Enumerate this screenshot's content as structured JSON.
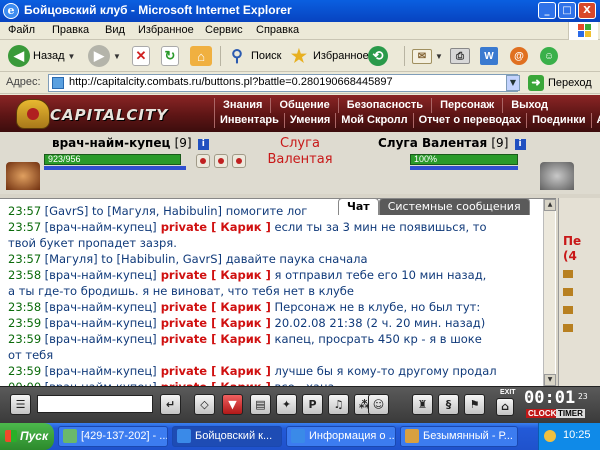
{
  "window": {
    "title": "Бойцовский клуб - Microsoft Internet Explorer",
    "minimize": "_",
    "maximize": "□",
    "close": "X"
  },
  "menu": [
    "Файл",
    "Правка",
    "Вид",
    "Избранное",
    "Сервис",
    "Справка"
  ],
  "toolbar": {
    "back": "Назад",
    "search": "Поиск",
    "favorites": "Избранное"
  },
  "address": {
    "label": "Адрес:",
    "url": "http://capitalcity.combats.ru/buttons.pl?battle=0.280190668445897",
    "go": "Переход"
  },
  "game": {
    "logo": "CAPITALCITY",
    "nav_top": [
      "Знания",
      "Общение",
      "Безопасность",
      "Персонаж",
      "Выход"
    ],
    "nav_bottom": [
      "Инвентарь",
      "Умения",
      "Мой Скролл",
      "Отчет о переводах",
      "Поединки",
      "Ан"
    ],
    "player": {
      "name": "врач-найм-купец",
      "level": "[9]",
      "hp_text": "923/956",
      "hp_fraction": 0.965
    },
    "vs_text_1": "Слуга",
    "vs_text_2": "Валентая",
    "enemy": {
      "name": "Слуга Валентая",
      "level": "[9]",
      "hp_text": "100%",
      "hp_fraction": 1.0
    },
    "tabs": {
      "chat": "Чат",
      "system": "Системные сообщения"
    },
    "chat": [
      {
        "time": "23:57",
        "nick": "[GavrS]",
        "priv": "",
        "text": " to [Магуля, Habibulin] помогите лог"
      },
      {
        "time": "23:57",
        "nick": "[врач-найм-купец]",
        "priv": " private [ Карик ]",
        "text": " если ты за 3 мин не появишься, то"
      },
      {
        "time": "",
        "nick": "",
        "priv": "",
        "text": "твой букет пропадет зазря."
      },
      {
        "time": "23:57",
        "nick": "[Магуля]",
        "priv": "",
        "text": " to [Habibulin, GavrS] давайте паука сначала"
      },
      {
        "time": "23:58",
        "nick": "[врач-найм-купец]",
        "priv": " private [ Карик ]",
        "text": " я отправил тебе его 10 мин назад,"
      },
      {
        "time": "",
        "nick": "",
        "priv": "",
        "text": "а ты где-то бродишь. я не виноват, что тебя нет в клубе"
      },
      {
        "time": "23:58",
        "nick": "[врач-найм-купец]",
        "priv": " private [ Карик ]",
        "text": " Персонаж не в клубе, но был тут:"
      },
      {
        "time": "23:59",
        "nick": "[врач-найм-купец]",
        "priv": " private [ Карик ]",
        "text": " 20.02.08 21:38 (2 ч. 20 мин. назад)"
      },
      {
        "time": "23:59",
        "nick": "[врач-найм-купец]",
        "priv": " private [ Карик ]",
        "text": " капец, просрать 450 кр - я в шоке"
      },
      {
        "time": "",
        "nick": "",
        "priv": "",
        "text": "от тебя"
      },
      {
        "time": "23:59",
        "nick": "[врач-найм-купец]",
        "priv": " private [ Карик ]",
        "text": " лучше бы я кому-то другому продал"
      },
      {
        "time": "00:00",
        "nick": "[врач-найм-купец]",
        "priv": " private [ Карик ]",
        "text": " все - хана"
      }
    ],
    "right_panel": {
      "title": "Пе",
      "sub": "(4"
    },
    "timer": {
      "digits": "00:01",
      "secs": "23",
      "clock": "CLOCK",
      "timer": "TIMER",
      "exit": "EXIT"
    }
  },
  "taskbar": {
    "start": "Пуск",
    "items": [
      "[429-137-202] - ...",
      "Бойцовский к...",
      "Информация о ...",
      "Безымянный - Р..."
    ],
    "clock": "10:25"
  },
  "colors": {
    "titlebar": "#0a5fe0",
    "game_bar": "#8a2525",
    "private_red": "#d01010",
    "chat_blue": "#103a7a",
    "time_green": "#0a6a0a"
  }
}
